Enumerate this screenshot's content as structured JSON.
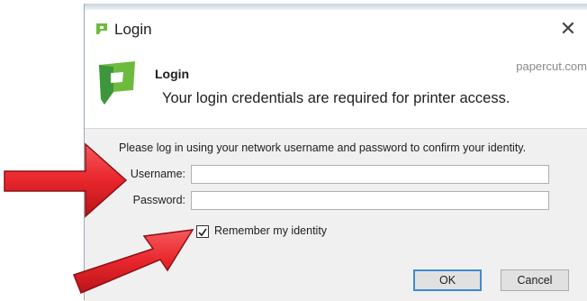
{
  "window": {
    "title": "Login",
    "close_glyph": "✕",
    "brand_link": "papercut.com",
    "icon": "papercut-logo-icon"
  },
  "header": {
    "title": "Login",
    "subtitle": "Your login credentials are required for printer access."
  },
  "form": {
    "instructions": "Please log in using your network username and password to confirm your identity.",
    "username_label": "Username:",
    "username_value": "",
    "password_label": "Password:",
    "password_value": "",
    "remember_label": "Remember my identity",
    "remember_checked": true
  },
  "buttons": {
    "ok_label": "OK",
    "cancel_label": "Cancel"
  },
  "annotations": {
    "arrow_color": "#e8262c",
    "arrow_count": 2
  },
  "colors": {
    "logo_green": "#6dbb3c",
    "logo_dark_green": "#2f8a3a",
    "panel_bg": "#f0f0f0",
    "focus_blue": "#3c8ad8"
  }
}
